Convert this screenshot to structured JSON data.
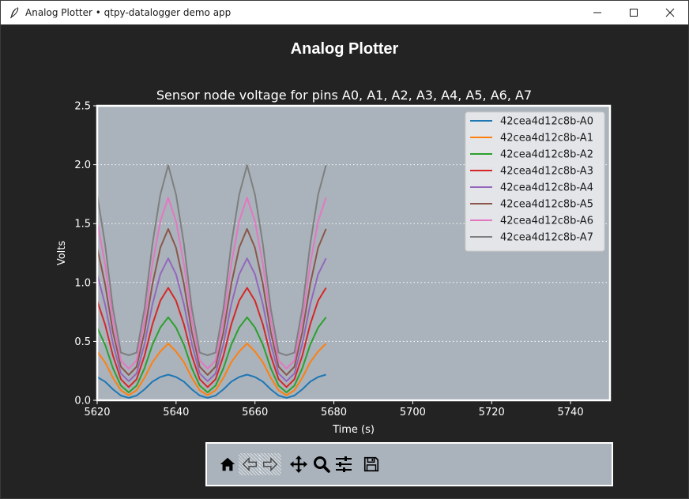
{
  "window": {
    "title": "Analog Plotter • qtpy-datalogger demo app",
    "controls": [
      "minimize",
      "maximize",
      "close"
    ]
  },
  "app": {
    "heading": "Analog Plotter"
  },
  "colors": {
    "background": "#232323",
    "axes_face": "#aab3bb",
    "text": "#ffffff"
  },
  "toolbar": {
    "buttons": [
      {
        "name": "home",
        "icon": "home-icon",
        "enabled": true
      },
      {
        "name": "back",
        "icon": "arrow-left-icon",
        "enabled": false
      },
      {
        "name": "forward",
        "icon": "arrow-right-icon",
        "enabled": false
      },
      {
        "name": "pan",
        "icon": "move-icon",
        "enabled": true
      },
      {
        "name": "zoom",
        "icon": "magnifier-icon",
        "enabled": true
      },
      {
        "name": "configure-subplots",
        "icon": "sliders-icon",
        "enabled": true
      },
      {
        "name": "save",
        "icon": "floppy-disk-icon",
        "enabled": true
      }
    ]
  },
  "chart_data": {
    "type": "line",
    "title": "Sensor node voltage for pins A0, A1, A2, A3, A4, A5, A6, A7",
    "xlabel": "Time (s)",
    "ylabel": "Volts",
    "xlim": [
      5620,
      5750
    ],
    "ylim": [
      0,
      2.5
    ],
    "xticks": [
      5620,
      5640,
      5660,
      5680,
      5700,
      5720,
      5740
    ],
    "xtick_labels": [
      "5620",
      "5640",
      "5660",
      "5680",
      "5700",
      "5720",
      "5740"
    ],
    "yticks": [
      0,
      0.5,
      1,
      1.5,
      2,
      2.5
    ],
    "ytick_labels": [
      "0.0",
      "0.5",
      "1.0",
      "1.5",
      "2.0",
      "2.5"
    ],
    "grid": "y-dotted",
    "legend_position": "top-right",
    "x": [
      5620,
      5622,
      5624,
      5626,
      5628,
      5630,
      5632,
      5634,
      5636,
      5638,
      5640,
      5642,
      5644,
      5646,
      5648,
      5650,
      5652,
      5654,
      5656,
      5658,
      5660,
      5662,
      5664,
      5666,
      5668,
      5670,
      5672,
      5674,
      5676,
      5678
    ],
    "series": [
      {
        "name": "42cea4d12c8b-A0",
        "color": "#1f77b4",
        "values": [
          0.198,
          0.158,
          0.093,
          0.04,
          0.021,
          0.04,
          0.093,
          0.158,
          0.198,
          0.218,
          0.198,
          0.158,
          0.093,
          0.04,
          0.021,
          0.04,
          0.093,
          0.158,
          0.198,
          0.218,
          0.198,
          0.158,
          0.093,
          0.04,
          0.021,
          0.04,
          0.093,
          0.158,
          0.198,
          0.218
        ]
      },
      {
        "name": "42cea4d12c8b-A1",
        "color": "#ff7f0e",
        "values": [
          0.414,
          0.323,
          0.191,
          0.085,
          0.043,
          0.085,
          0.191,
          0.323,
          0.414,
          0.482,
          0.414,
          0.323,
          0.191,
          0.085,
          0.043,
          0.085,
          0.191,
          0.323,
          0.414,
          0.482,
          0.414,
          0.323,
          0.191,
          0.085,
          0.043,
          0.085,
          0.191,
          0.323,
          0.414,
          0.482
        ]
      },
      {
        "name": "42cea4d12c8b-A2",
        "color": "#2ca02c",
        "values": [
          0.617,
          0.472,
          0.272,
          0.125,
          0.067,
          0.125,
          0.272,
          0.472,
          0.617,
          0.705,
          0.617,
          0.472,
          0.272,
          0.125,
          0.067,
          0.125,
          0.272,
          0.472,
          0.617,
          0.705,
          0.617,
          0.472,
          0.272,
          0.125,
          0.067,
          0.125,
          0.272,
          0.472,
          0.617,
          0.705
        ]
      },
      {
        "name": "42cea4d12c8b-A3",
        "color": "#d62728",
        "values": [
          0.845,
          0.644,
          0.378,
          0.179,
          0.112,
          0.179,
          0.378,
          0.644,
          0.845,
          0.955,
          0.845,
          0.644,
          0.378,
          0.179,
          0.112,
          0.179,
          0.378,
          0.644,
          0.845,
          0.955,
          0.845,
          0.644,
          0.378,
          0.179,
          0.112,
          0.179,
          0.378,
          0.644,
          0.845,
          0.955
        ]
      },
      {
        "name": "42cea4d12c8b-A4",
        "color": "#9467bd",
        "values": [
          1.07,
          0.814,
          0.478,
          0.228,
          0.162,
          0.228,
          0.478,
          0.814,
          1.07,
          1.205,
          1.07,
          0.814,
          0.478,
          0.228,
          0.162,
          0.228,
          0.478,
          0.814,
          1.07,
          1.205,
          1.07,
          0.814,
          0.478,
          0.228,
          0.162,
          0.228,
          0.478,
          0.814,
          1.07,
          1.205
        ]
      },
      {
        "name": "42cea4d12c8b-A5",
        "color": "#8c564b",
        "values": [
          1.295,
          0.985,
          0.578,
          0.285,
          0.215,
          0.285,
          0.578,
          0.985,
          1.295,
          1.455,
          1.295,
          0.985,
          0.578,
          0.285,
          0.215,
          0.285,
          0.578,
          0.985,
          1.295,
          1.455,
          1.295,
          0.985,
          0.578,
          0.285,
          0.215,
          0.285,
          0.578,
          0.985,
          1.295,
          1.455
        ]
      },
      {
        "name": "42cea4d12c8b-A6",
        "color": "#e377c2",
        "values": [
          1.52,
          1.155,
          0.678,
          0.338,
          0.268,
          0.338,
          0.678,
          1.155,
          1.52,
          1.72,
          1.52,
          1.155,
          0.678,
          0.338,
          0.268,
          0.338,
          0.678,
          1.155,
          1.52,
          1.72,
          1.52,
          1.155,
          0.678,
          0.338,
          0.268,
          0.338,
          0.678,
          1.155,
          1.52,
          1.72
        ]
      },
      {
        "name": "42cea4d12c8b-A7",
        "color": "#7f7f7f",
        "values": [
          1.745,
          1.325,
          0.778,
          0.405,
          0.382,
          0.405,
          0.778,
          1.325,
          1.745,
          1.995,
          1.745,
          1.325,
          0.778,
          0.405,
          0.382,
          0.405,
          0.778,
          1.325,
          1.745,
          1.995,
          1.745,
          1.325,
          0.778,
          0.405,
          0.382,
          0.405,
          0.778,
          1.325,
          1.745,
          1.995
        ]
      }
    ]
  }
}
